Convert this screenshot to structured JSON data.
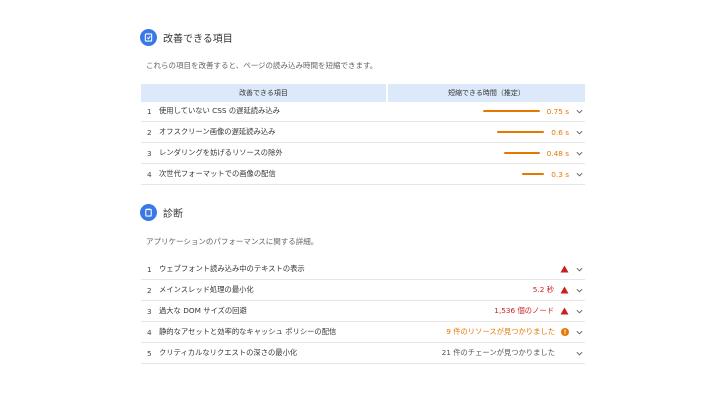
{
  "opportunities": {
    "title": "改善できる項目",
    "description": "これらの項目を改善すると、ページの読み込み時間を短縮できます。",
    "col_item": "改善できる項目",
    "col_savings": "短縮できる時間（推定）",
    "items": [
      {
        "num": "1",
        "title": "使用していない CSS の遅延読み込み",
        "savings": "0.75 s",
        "savings_fraction": 0.75
      },
      {
        "num": "2",
        "title": "オフスクリーン画像の遅延読み込み",
        "savings": "0.6 s",
        "savings_fraction": 0.6
      },
      {
        "num": "3",
        "title": "レンダリングを妨げるリソースの除外",
        "savings": "0.48 s",
        "savings_fraction": 0.48
      },
      {
        "num": "4",
        "title": "次世代フォーマットでの画像の配信",
        "savings": "0.3 s",
        "savings_fraction": 0.3
      }
    ]
  },
  "diagnostics": {
    "title": "診断",
    "description": "アプリケーションのパフォーマンスに関する詳細。",
    "items": [
      {
        "num": "1",
        "title": "ウェブフォント読み込み中のテキストの表示",
        "value": "",
        "status": "fail"
      },
      {
        "num": "2",
        "title": "メインスレッド処理の最小化",
        "value": "5.2 秒",
        "status": "fail"
      },
      {
        "num": "3",
        "title": "過大な DOM サイズの回避",
        "value": "1,536 個のノード",
        "status": "fail"
      },
      {
        "num": "4",
        "title": "静的なアセットと効率的なキャッシュ ポリシーの配信",
        "value": "9 件のリソースが見つかりました",
        "status": "average"
      },
      {
        "num": "5",
        "title": "クリティカルなリクエストの深さの最小化",
        "value": "21 件のチェーンが見つかりました",
        "status": "info"
      }
    ]
  },
  "colors": {
    "accent": "#3b78e7",
    "orange": "#e67700",
    "red": "#c5221f",
    "header_bg": "#dce9fb"
  }
}
